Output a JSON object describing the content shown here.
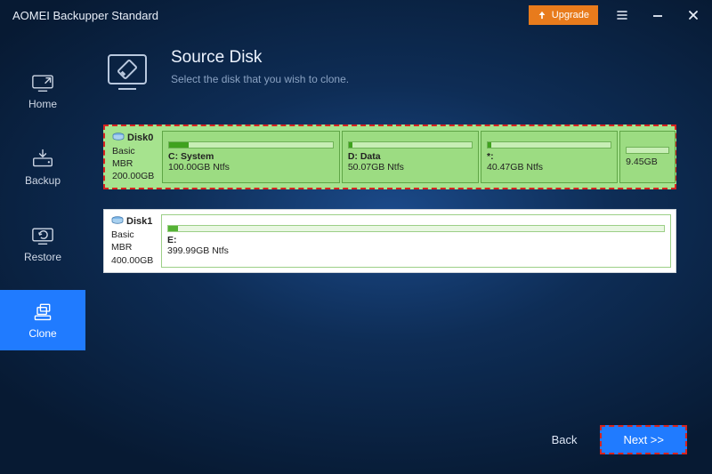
{
  "app_title": "AOMEI Backupper Standard",
  "titlebar": {
    "upgrade_label": "Upgrade"
  },
  "sidebar": {
    "items": [
      {
        "id": "home",
        "label": "Home"
      },
      {
        "id": "backup",
        "label": "Backup"
      },
      {
        "id": "restore",
        "label": "Restore"
      },
      {
        "id": "clone",
        "label": "Clone"
      }
    ],
    "active_id": "clone"
  },
  "page": {
    "title": "Source Disk",
    "subtitle": "Select the disk that you wish to clone."
  },
  "disks": [
    {
      "id": "disk0",
      "name": "Disk0",
      "type": "Basic MBR",
      "size": "200.00GB",
      "selected": true,
      "partitions": [
        {
          "label": "C: System",
          "size": "100.00GB Ntfs",
          "width_pct": 35,
          "fill_pct": 12
        },
        {
          "label": "D: Data",
          "size": "50.07GB Ntfs",
          "width_pct": 27,
          "fill_pct": 3
        },
        {
          "label": "*:",
          "size": "40.47GB Ntfs",
          "width_pct": 27,
          "fill_pct": 3
        },
        {
          "label": "",
          "size": "9.45GB",
          "width_pct": 11,
          "fill_pct": 0
        }
      ]
    },
    {
      "id": "disk1",
      "name": "Disk1",
      "type": "Basic MBR",
      "size": "400.00GB",
      "selected": false,
      "partitions": [
        {
          "label": "E:",
          "size": "399.99GB Ntfs",
          "width_pct": 100,
          "fill_pct": 2
        }
      ]
    }
  ],
  "footer": {
    "back_label": "Back",
    "next_label": "Next >>"
  }
}
